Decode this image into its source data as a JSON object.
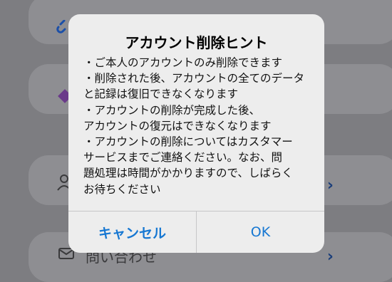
{
  "background": {
    "contact_label": "問い合わせ"
  },
  "dialog": {
    "title": "アカウント削除ヒント",
    "lines": [
      "・ご本人のアカウントのみ削除できます",
      "・削除された後、アカウントの全てのデータ",
      "と記録は復旧できなくなります",
      "・アカウントの削除が完成した後、",
      "アカウントの復元はできなくなります",
      "・アカウントの削除についてはカスタマー",
      "サービスまでご連絡ください。なお、問",
      "題処理は時間がかかりますので、しばらく",
      "お待ちください"
    ],
    "cancel_label": "キャンセル",
    "ok_label": "OK"
  },
  "colors": {
    "accent": "#1677d2",
    "overlay": "#7d7d81",
    "dialog_bg": "#ededed"
  },
  "icons": [
    "link-icon",
    "diamond-icon",
    "person-icon",
    "mail-icon",
    "chevron-right-icon"
  ]
}
